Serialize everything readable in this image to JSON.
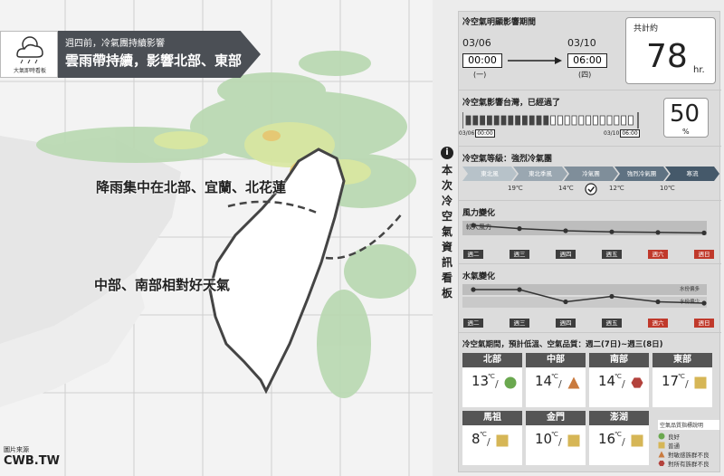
{
  "map": {
    "logo_text": "大氣即時看板",
    "headline_small": "週四前，冷氣團持續影響",
    "headline_big": "雲雨帶持續，影響北部、東部",
    "label_north": "降雨集中在北部、宜蘭、北花蓮",
    "label_south": "中部、南部相對好天氣",
    "source_label": "圖片來源",
    "source_value": "CWB.TW"
  },
  "vertical_title": [
    "本",
    "次",
    "冷",
    "空",
    "氣",
    "資",
    "訊",
    "看",
    "板"
  ],
  "period": {
    "title": "冷空氣明顯影響期間",
    "start_date": "03/06",
    "start_time": "00:00",
    "start_day": "(一)",
    "end_date": "03/10",
    "end_time": "06:00",
    "end_day": "(四)",
    "total_label": "共計約",
    "total_value": "78",
    "total_unit": "hr."
  },
  "progress": {
    "title": "冷空氣影響台灣，已經過了",
    "percent": "50",
    "unit": "%",
    "fraction": 0.5,
    "start_date": "03/06",
    "start_time": "00:00",
    "end_date": "03/10",
    "end_time": "06:00"
  },
  "level": {
    "title": "冷空氣等級：強烈冷氣團",
    "steps": [
      "東北風",
      "東北季風",
      "冷氣團",
      "強烈冷氣團",
      "寒流"
    ],
    "temps": [
      "19℃",
      "14℃",
      "12℃",
      "10℃"
    ],
    "current_index": 2,
    "colors": [
      "#b7c2c9",
      "#9aa7b1",
      "#7f8e9a",
      "#5f7282",
      "#45596a"
    ]
  },
  "wind": {
    "title": "風力變化",
    "band_label": "較大風力",
    "days": [
      "週二",
      "週三",
      "週四",
      "週五",
      "週六",
      "週日"
    ],
    "holiday": [
      false,
      false,
      false,
      false,
      true,
      true
    ],
    "levels": [
      0.9,
      0.78,
      0.7,
      0.66,
      0.64,
      0.62
    ]
  },
  "rain": {
    "title": "水氣變化",
    "band_high": "水份偏多",
    "band_low": "水份偏少",
    "days": [
      "週二",
      "週三",
      "週四",
      "週五",
      "週六",
      "週日"
    ],
    "holiday": [
      false,
      false,
      false,
      false,
      true,
      true
    ],
    "levels": [
      0.8,
      0.8,
      0.35,
      0.55,
      0.35,
      0.3
    ]
  },
  "forecast": {
    "title": "冷空氣期間，預計低溫、空氣品質：週二(7日)~週三(8日)",
    "unit": "℃",
    "slash": "/",
    "regions": [
      {
        "name": "北部",
        "temp": "13",
        "aq": "good"
      },
      {
        "name": "中部",
        "temp": "14",
        "aq": "sensitive"
      },
      {
        "name": "南部",
        "temp": "14",
        "aq": "unhealthy"
      },
      {
        "name": "東部",
        "temp": "17",
        "aq": "moderate"
      },
      {
        "name": "馬祖",
        "temp": "8",
        "aq": "moderate"
      },
      {
        "name": "金門",
        "temp": "10",
        "aq": "moderate"
      },
      {
        "name": "澎湖",
        "temp": "16",
        "aq": "moderate"
      }
    ],
    "legend_title": "空氣品質指標說明",
    "legend": [
      {
        "icon": "good",
        "label": "良好"
      },
      {
        "icon": "moderate",
        "label": "普通"
      },
      {
        "icon": "sensitive",
        "label": "對敏感族群不良"
      },
      {
        "icon": "unhealthy",
        "label": "對所有族群不良"
      }
    ],
    "aq_colors": {
      "good": "#6aa84f",
      "moderate": "#d6b656",
      "sensitive": "#c97a3e",
      "unhealthy": "#b3423c"
    }
  }
}
